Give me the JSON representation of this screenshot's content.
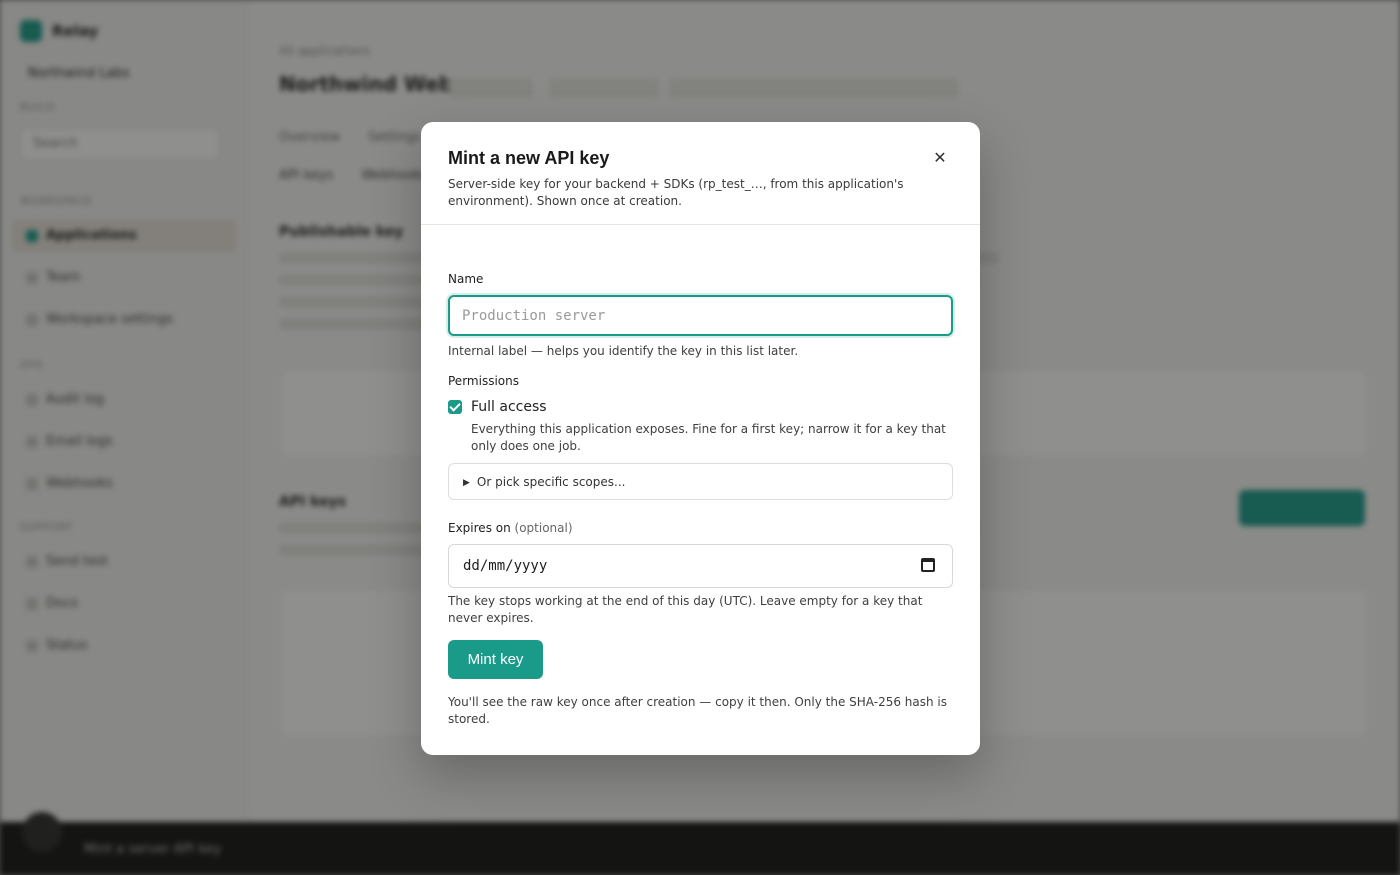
{
  "background": {
    "brand": "Relay",
    "workspace": "Northwind Labs",
    "search_placeholder": "Search",
    "sections": [
      "Build",
      "Workspace",
      "Ops",
      "Support"
    ],
    "nav_items": [
      "Applications",
      "Team",
      "Workspace settings",
      "Audit log",
      "Email logs",
      "Webhooks",
      "Send test",
      "Docs",
      "Status"
    ],
    "page_title": "Northwind Web",
    "breadcrumb": "All applications",
    "tabs": [
      "Overview",
      "Settings"
    ],
    "subtabs": [
      "API keys",
      "Webhooks"
    ],
    "section_publishable": "Publishable key",
    "section_api_keys": "API keys",
    "bottom_text": "Mint a server API key"
  },
  "modal": {
    "title": "Mint a new API key",
    "subtitle": "Server-side key for your backend + SDKs (rp_test_…, from this application's environment). Shown once at creation.",
    "name_label": "Name",
    "name_placeholder": "Production server",
    "name_value": "",
    "name_hint": "Internal label — helps you identify the key in this list later.",
    "permissions_label": "Permissions",
    "full_access_label": "Full access",
    "full_access_checked": true,
    "full_access_desc": "Everything this application exposes. Fine for a first key; narrow it for a key that only does one job.",
    "scopes_summary": "Or pick specific scopes...",
    "expires_label": "Expires on",
    "expires_optional": "(optional)",
    "expires_placeholder": "dd/mm/yyyy",
    "expires_hint": "The key stops working at the end of this day (UTC). Leave empty for a key that never expires.",
    "submit_label": "Mint key",
    "footer_note": "You'll see the raw key once after creation — copy it then. Only the SHA-256 hash is stored.",
    "close_icon": "close-icon"
  },
  "colors": {
    "accent": "#1a9b8a"
  }
}
